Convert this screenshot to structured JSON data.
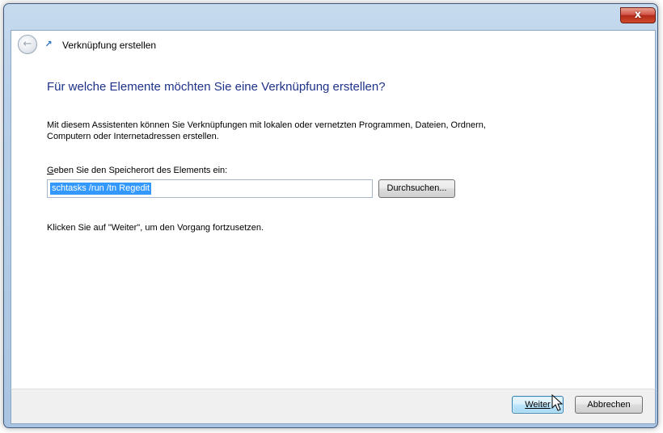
{
  "window": {
    "close_glyph": "x",
    "close_icon": "close-icon"
  },
  "header": {
    "back_icon": "back-arrow-icon",
    "wizard_icon": "shortcut-wizard-icon",
    "title": "Verknüpfung erstellen"
  },
  "main": {
    "heading": "Für welche Elemente möchten Sie eine Verknüpfung erstellen?",
    "description": "Mit diesem Assistenten können Sie Verknüpfungen mit lokalen oder vernetzten Programmen, Dateien, Ordnern, Computern oder Internetadressen erstellen.",
    "location_label_access": "G",
    "location_label_rest": "eben Sie den Speicherort des Elements ein:",
    "location_value": "schtasks /run /tn Regedit",
    "browse_label": "Durchsuchen...",
    "continue_hint": "Klicken Sie auf \"Weiter\", um den Vorgang fortzusetzen."
  },
  "footer": {
    "next_label": "Weiter",
    "cancel_label": "Abbrechen"
  },
  "colors": {
    "heading": "#1e3287",
    "selection": "#3399ff",
    "close_button": "#c7402a"
  }
}
